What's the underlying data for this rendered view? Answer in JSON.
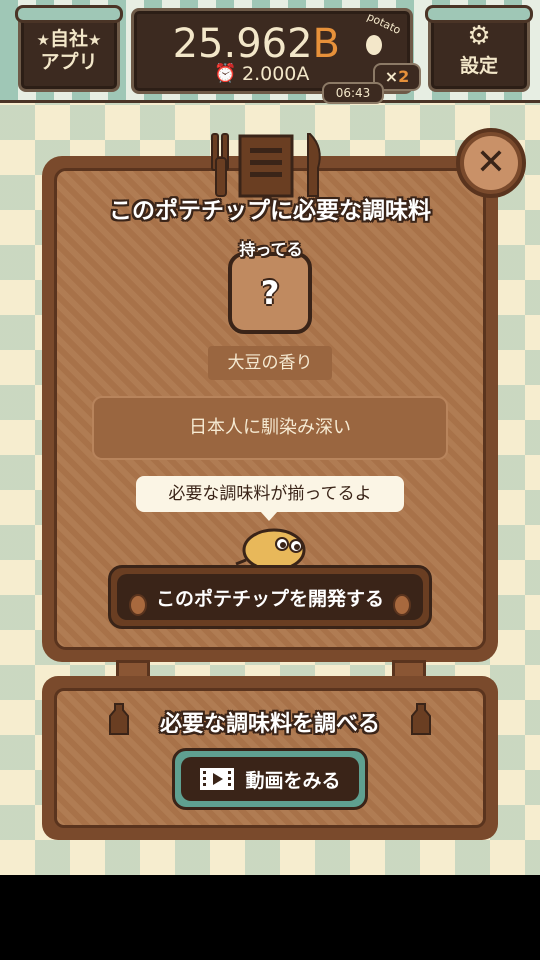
{
  "topbar": {
    "apps_label_line1": "自社",
    "apps_label_line2": "アプリ",
    "money_value": "25.962",
    "money_unit": "B",
    "potato_word": "potato",
    "rate_value": "2.000A",
    "multiplier_symbol": "×",
    "multiplier_value": "2",
    "timer": "06:43",
    "settings_label": "設定"
  },
  "board": {
    "title": "このポテチップに必要な調味料",
    "have_label": "持ってる",
    "item_symbol": "?",
    "seasoning_name": "大豆の香り",
    "description": "日本人に馴染み深い",
    "speech": "必要な調味料が揃ってるよ",
    "develop_button": "このポテチップを開発する",
    "close_symbol": "✕"
  },
  "bottom": {
    "title": "必要な調味料を調べる",
    "video_button": "動画をみる"
  },
  "colors": {
    "accent_orange": "#e7913a",
    "board_brown": "#7a4a2c",
    "dark_brown": "#3a2418",
    "teal": "#5fa090"
  },
  "icons": [
    "star-icon",
    "potato-icon",
    "alarm-clock-icon",
    "gear-icon",
    "menu-icon",
    "close-icon",
    "mascot-potato",
    "film-icon"
  ]
}
